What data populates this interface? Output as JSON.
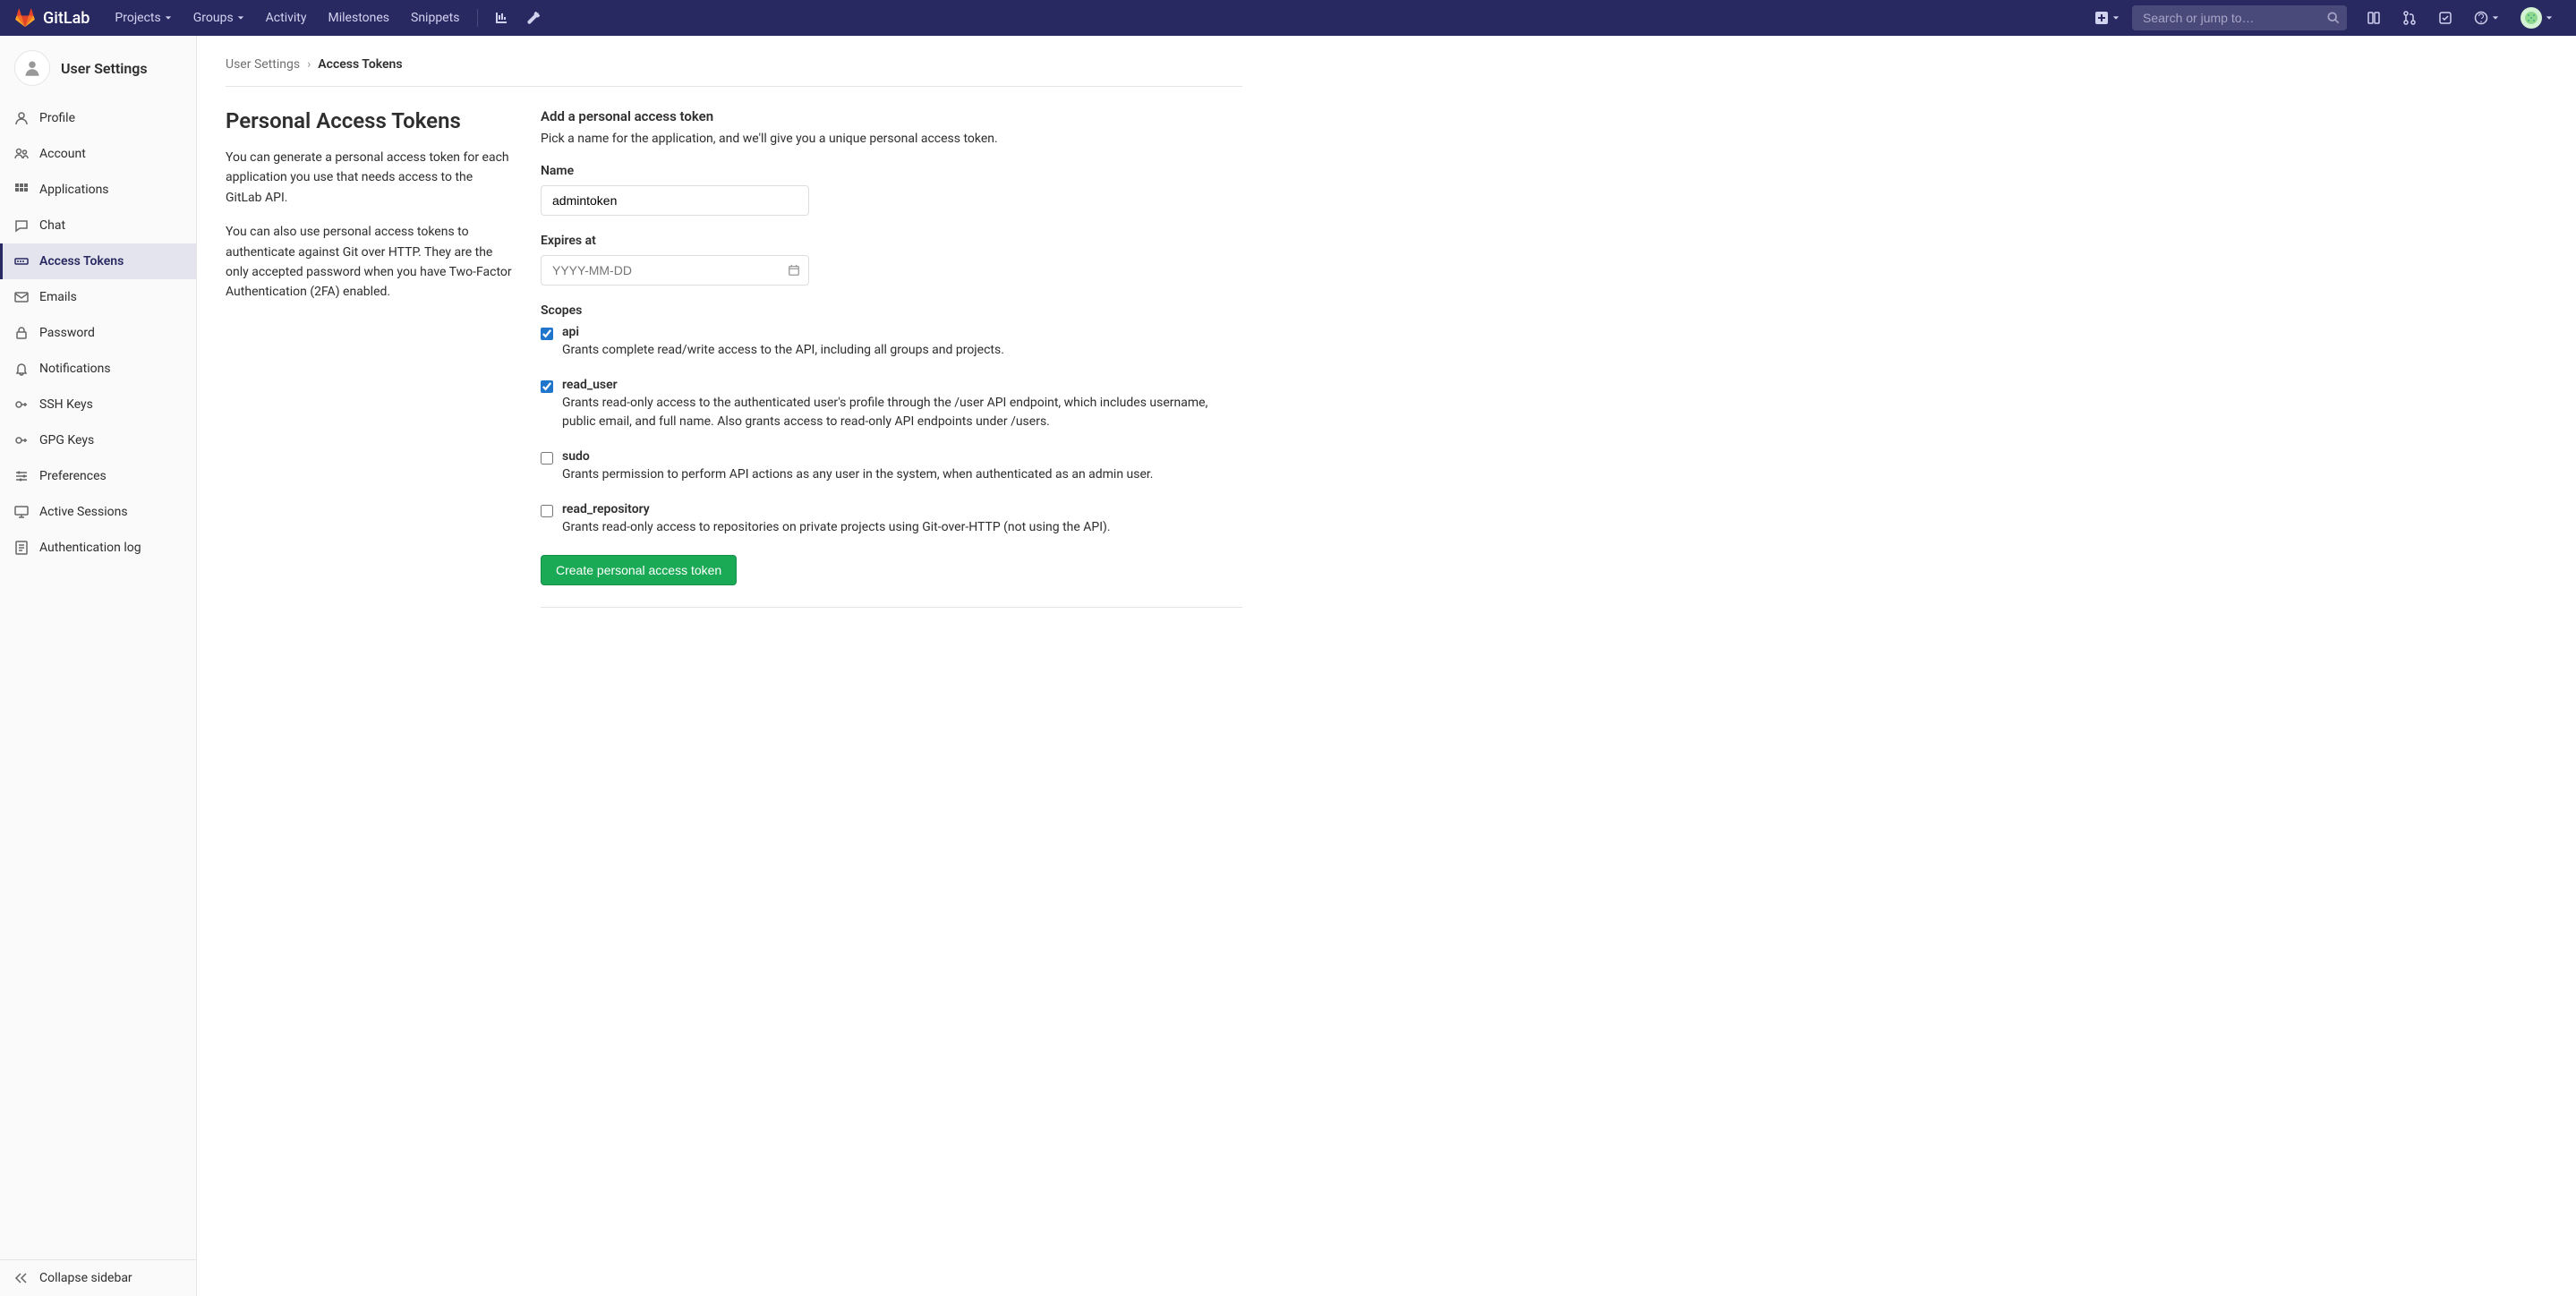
{
  "brand": "GitLab",
  "nav": {
    "projects": "Projects",
    "groups": "Groups",
    "activity": "Activity",
    "milestones": "Milestones",
    "snippets": "Snippets"
  },
  "search": {
    "placeholder": "Search or jump to…"
  },
  "sidebar": {
    "title": "User Settings",
    "items": [
      {
        "label": "Profile"
      },
      {
        "label": "Account"
      },
      {
        "label": "Applications"
      },
      {
        "label": "Chat"
      },
      {
        "label": "Access Tokens"
      },
      {
        "label": "Emails"
      },
      {
        "label": "Password"
      },
      {
        "label": "Notifications"
      },
      {
        "label": "SSH Keys"
      },
      {
        "label": "GPG Keys"
      },
      {
        "label": "Preferences"
      },
      {
        "label": "Active Sessions"
      },
      {
        "label": "Authentication log"
      }
    ],
    "collapse": "Collapse sidebar"
  },
  "breadcrumb": {
    "parent": "User Settings",
    "current": "Access Tokens"
  },
  "page": {
    "title": "Personal Access Tokens",
    "desc1": "You can generate a personal access token for each application you use that needs access to the GitLab API.",
    "desc2": "You can also use personal access tokens to authenticate against Git over HTTP. They are the only accepted password when you have Two-Factor Authentication (2FA) enabled."
  },
  "form": {
    "title": "Add a personal access token",
    "subtitle": "Pick a name for the application, and we'll give you a unique personal access token.",
    "name_label": "Name",
    "name_value": "admintoken",
    "expires_label": "Expires at",
    "expires_placeholder": "YYYY-MM-DD",
    "scopes_label": "Scopes",
    "scopes": [
      {
        "name": "api",
        "desc": "Grants complete read/write access to the API, including all groups and projects.",
        "checked": true
      },
      {
        "name": "read_user",
        "desc": "Grants read-only access to the authenticated user's profile through the /user API endpoint, which includes username, public email, and full name. Also grants access to read-only API endpoints under /users.",
        "checked": true
      },
      {
        "name": "sudo",
        "desc": "Grants permission to perform API actions as any user in the system, when authenticated as an admin user.",
        "checked": false
      },
      {
        "name": "read_repository",
        "desc": "Grants read-only access to repositories on private projects using Git-over-HTTP (not using the API).",
        "checked": false
      }
    ],
    "submit": "Create personal access token"
  }
}
